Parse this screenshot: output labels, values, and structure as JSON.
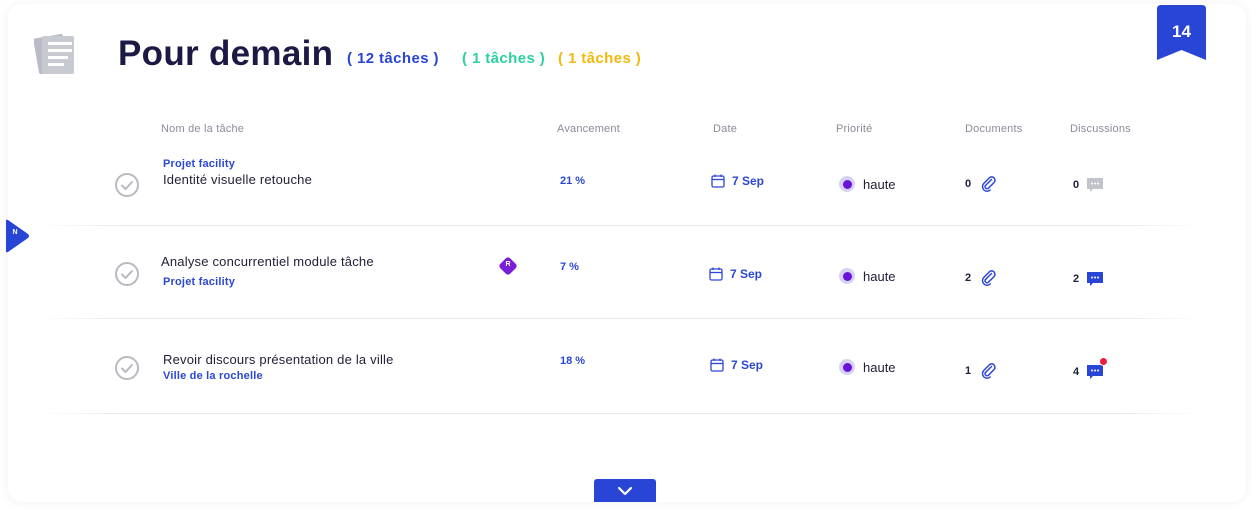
{
  "header": {
    "title": "Pour demain",
    "counts": {
      "total": "( 12 tâches )",
      "green": "( 1 tâches )",
      "yellow": "( 1 tâches )"
    },
    "badge_number": "14"
  },
  "side_tab": {
    "letter": "N"
  },
  "columns": {
    "name": "Nom de la tâche",
    "progress": "Avancement",
    "date": "Date",
    "priority": "Priorité",
    "documents": "Documents",
    "discussions": "Discussions"
  },
  "tasks": [
    {
      "project": "Projet facility",
      "name": "Identité visuelle retouche",
      "progress": "21 %",
      "date": "7 Sep",
      "priority": "haute",
      "documents": "0",
      "discussions": "0",
      "discussion_icon": "chat-icon-inactive"
    },
    {
      "project": "Projet facility",
      "name": "Analyse concurrentiel module tâche",
      "assignee": "R",
      "progress": "7 %",
      "date": "7 Sep",
      "priority": "haute",
      "documents": "2",
      "discussions": "2",
      "discussion_icon": "chat-icon-active"
    },
    {
      "project": "Ville de la rochelle",
      "name": "Revoir discours présentation de la ville",
      "progress": "18 %",
      "date": "7 Sep",
      "priority": "haute",
      "documents": "1",
      "discussions": "4",
      "discussion_icon": "chat-icon-unread"
    }
  ],
  "colors": {
    "accent": "#2845d6",
    "title": "#1c1a45",
    "green": "#2bd1a0",
    "yellow": "#f2b80b",
    "priority": "#6a12d8",
    "notification": "#ee1b3c"
  }
}
